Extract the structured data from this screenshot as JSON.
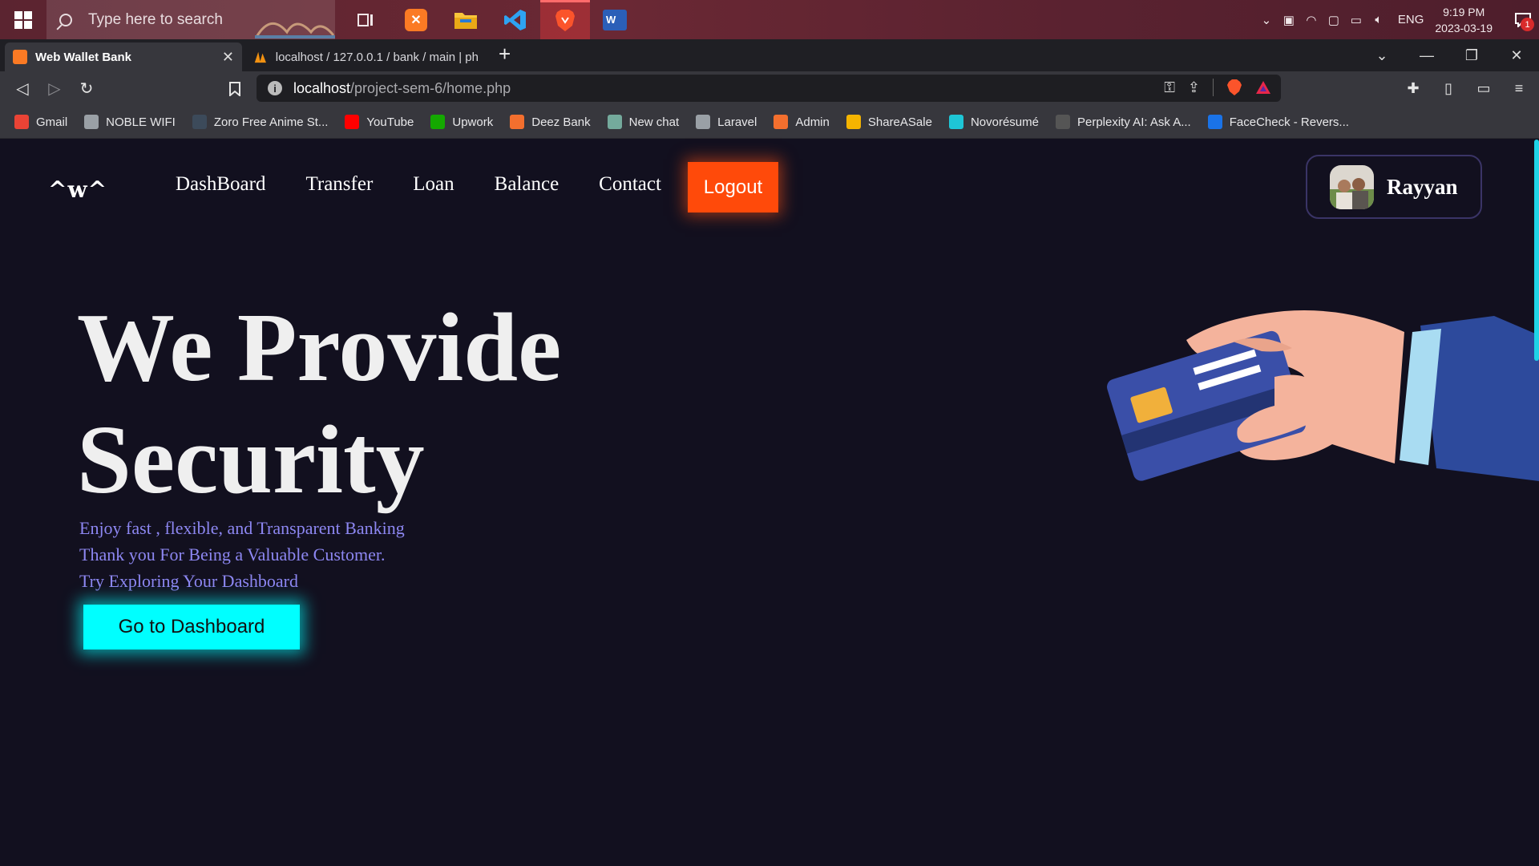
{
  "taskbar": {
    "search_placeholder": "Type here to search",
    "apps": [
      "task-view-icon",
      "xampp-icon",
      "file-explorer-icon",
      "vscode-icon",
      "brave-icon",
      "word-icon"
    ],
    "tray": {
      "language": "ENG",
      "time": "9:19 PM",
      "date": "2023-03-19",
      "notification_count": "1"
    }
  },
  "browser": {
    "tabs": [
      {
        "title": "Web Wallet Bank",
        "active": true
      },
      {
        "title": "localhost / 127.0.0.1 / bank / main | ph",
        "active": false
      }
    ],
    "address": {
      "host": "localhost",
      "path": "/project-sem-6/home.php"
    },
    "bookmarks": [
      {
        "label": "Gmail",
        "icon": "gmail-icon",
        "color": "#ea4335"
      },
      {
        "label": "NOBLE WIFI",
        "icon": "globe-icon",
        "color": "#9aa0a6"
      },
      {
        "label": "Zoro Free Anime St...",
        "icon": "zoro-icon",
        "color": "#3c4a5a"
      },
      {
        "label": "YouTube",
        "icon": "youtube-icon",
        "color": "#ff0000"
      },
      {
        "label": "Upwork",
        "icon": "upwork-icon",
        "color": "#14a800"
      },
      {
        "label": "Deez Bank",
        "icon": "xampp-icon",
        "color": "#f36f2e"
      },
      {
        "label": "New chat",
        "icon": "chatgpt-icon",
        "color": "#74aa9c"
      },
      {
        "label": "Laravel",
        "icon": "globe-icon",
        "color": "#9aa0a6"
      },
      {
        "label": "Admin",
        "icon": "xampp-icon",
        "color": "#f36f2e"
      },
      {
        "label": "ShareASale",
        "icon": "sharesale-icon",
        "color": "#f5b400"
      },
      {
        "label": "Novorésumé",
        "icon": "novoresume-icon",
        "color": "#1ec6d6"
      },
      {
        "label": "Perplexity AI: Ask A...",
        "icon": "grid-icon",
        "color": "#555555"
      },
      {
        "label": "FaceCheck - Revers...",
        "icon": "facecheck-icon",
        "color": "#1a73e8"
      }
    ]
  },
  "site": {
    "logo": "^w^",
    "nav": [
      "DashBoard",
      "Transfer",
      "Loan",
      "Balance",
      "Contact"
    ],
    "logout": "Logout",
    "user": "Rayyan",
    "hero": {
      "title_line1": "We Provide",
      "title_line2": "Security",
      "lines": [
        "Enjoy fast , flexible, and Transparent Banking",
        "Thank you For Being a Valuable Customer.",
        "Try Exploring Your Dashboard"
      ],
      "cta": "Go to Dashboard"
    },
    "colors": {
      "background": "#12101f",
      "logout": "#ff4a0a",
      "cta": "#00ffff",
      "subtext": "#8d87f2"
    }
  }
}
